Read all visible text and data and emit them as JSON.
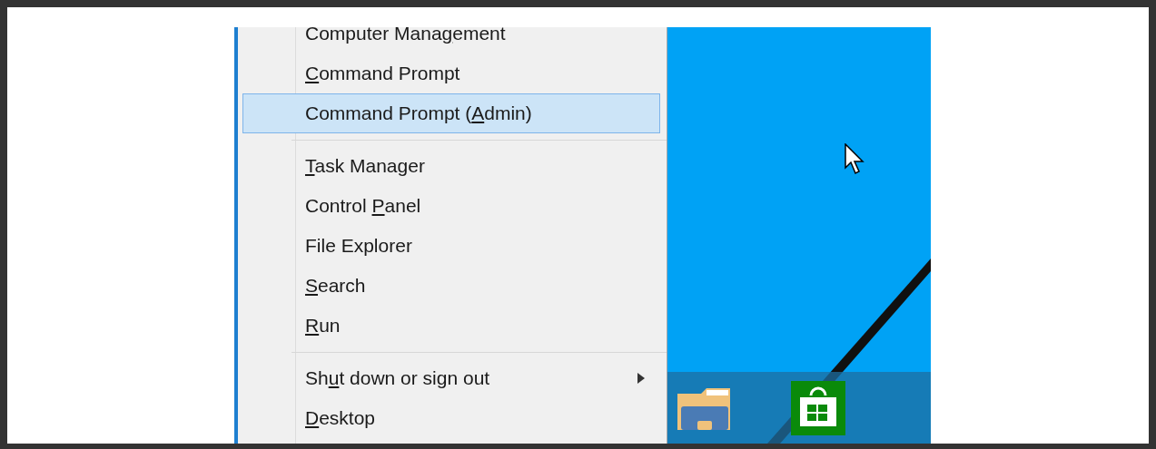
{
  "menu": {
    "items": [
      {
        "kind": "item",
        "pre": "Computer Mana",
        "key": "g",
        "post": "ement",
        "selected": false,
        "submenu": false
      },
      {
        "kind": "item",
        "key": "C",
        "post": "ommand Prompt",
        "selected": false,
        "submenu": false
      },
      {
        "kind": "item",
        "pre": "Command Prompt (",
        "key": "A",
        "post": "dmin)",
        "selected": true,
        "submenu": false
      },
      {
        "kind": "separator"
      },
      {
        "kind": "item",
        "key": "T",
        "post": "ask Manager",
        "selected": false,
        "submenu": false
      },
      {
        "kind": "item",
        "pre": "Control ",
        "key": "P",
        "post": "anel",
        "selected": false,
        "submenu": false
      },
      {
        "kind": "item",
        "pre": "File Explorer",
        "selected": false,
        "submenu": false
      },
      {
        "kind": "item",
        "key": "S",
        "post": "earch",
        "selected": false,
        "submenu": false
      },
      {
        "kind": "item",
        "key": "R",
        "post": "un",
        "selected": false,
        "submenu": false
      },
      {
        "kind": "separator"
      },
      {
        "kind": "item",
        "pre": "Sh",
        "key": "u",
        "post": "t down or sign out",
        "selected": false,
        "submenu": true
      },
      {
        "kind": "item",
        "key": "D",
        "post": "esktop",
        "selected": false,
        "submenu": false
      }
    ]
  }
}
